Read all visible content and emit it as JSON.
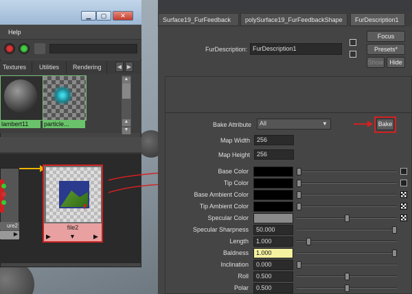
{
  "hypershade": {
    "menu_help": "Help",
    "tabs": [
      "Textures",
      "Utilities",
      "Rendering"
    ],
    "swatches": [
      {
        "label": "lambert11"
      },
      {
        "label": "particle..."
      }
    ],
    "node_left_label": "ure2",
    "file_node_label": "file2"
  },
  "attribute_editor": {
    "tabs": [
      "Surface19_FurFeedback",
      "polySurface19_FurFeedbackShape",
      "FurDescription1"
    ],
    "fur_description_label": "FurDescription:",
    "fur_description_value": "FurDescription1",
    "buttons": {
      "focus": "Focus",
      "presets": "Presets*",
      "show": "Show",
      "hide": "Hide",
      "bake": "Bake"
    },
    "bake_attribute_label": "Bake Attribute",
    "bake_attribute_value": "All",
    "map_width_label": "Map Width",
    "map_width_value": "256",
    "map_height_label": "Map Height",
    "map_height_value": "256",
    "attributes": [
      {
        "label": "Base Color",
        "value": "",
        "kind": "color",
        "color": "#000000",
        "slider": 0.0
      },
      {
        "label": "Tip Color",
        "value": "",
        "kind": "color",
        "color": "#000000",
        "slider": 0.0
      },
      {
        "label": "Base Ambient Color",
        "value": "",
        "kind": "color",
        "color": "#000000",
        "slider": 0.0
      },
      {
        "label": "Tip Ambient Color",
        "value": "",
        "kind": "color",
        "color": "#000000",
        "slider": 0.0
      },
      {
        "label": "Specular Color",
        "value": "",
        "kind": "color",
        "color": "#8a8a8a",
        "slider": 0.5
      },
      {
        "label": "Specular Sharpness",
        "value": "50.000",
        "kind": "number",
        "slider": 1.0
      },
      {
        "label": "Length",
        "value": "1.000",
        "kind": "number",
        "slider": 0.1
      },
      {
        "label": "Baldness",
        "value": "1.000",
        "kind": "number",
        "slider": 1.0,
        "highlight": "#f3f0a0"
      },
      {
        "label": "Inclination",
        "value": "0.000",
        "kind": "number",
        "slider": 0.0
      },
      {
        "label": "Roll",
        "value": "0.500",
        "kind": "number",
        "slider": 0.5
      },
      {
        "label": "Polar",
        "value": "0.500",
        "kind": "number",
        "slider": 0.5
      }
    ]
  },
  "colors": {
    "annotation_red": "#d42020",
    "connection_yellow": "#f0b400",
    "swatch_green": "#6ac36a"
  }
}
